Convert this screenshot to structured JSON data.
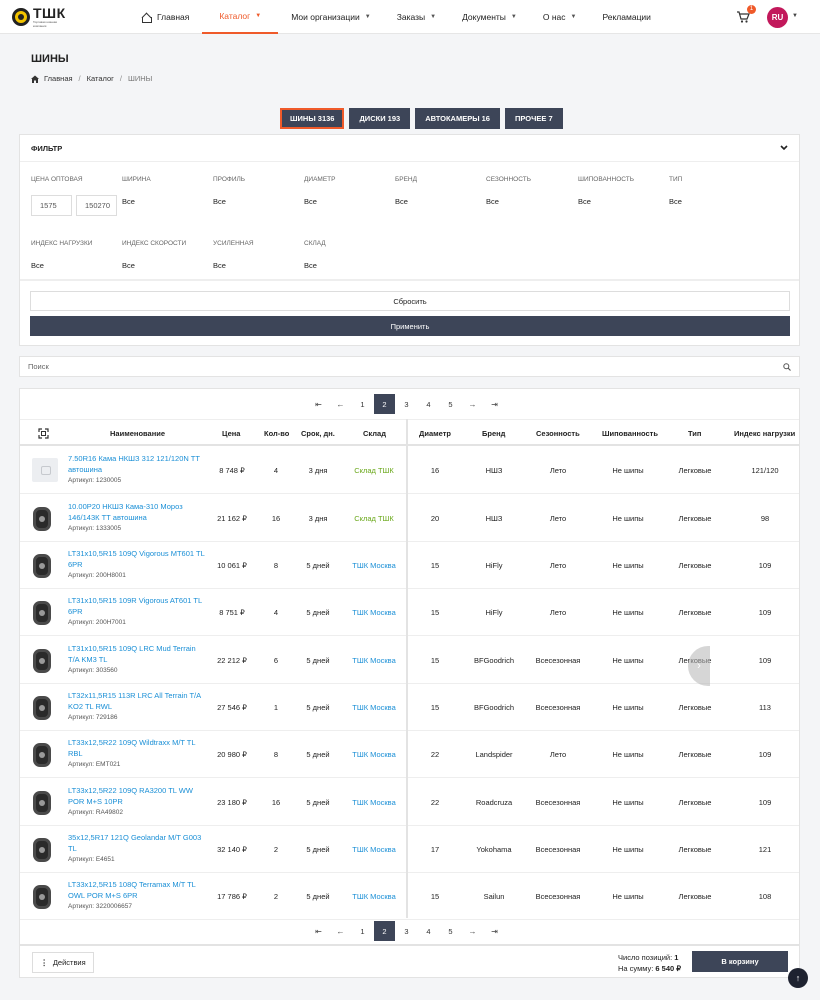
{
  "logo": {
    "text": "ТШК",
    "subtitle": "Торговая шинная компания"
  },
  "nav": {
    "home": "Главная",
    "catalog": "Каталог",
    "orgs": "Мои организации",
    "orders": "Заказы",
    "docs": "Документы",
    "about": "О нас",
    "ads": "Рекламации"
  },
  "header": {
    "cart_count": "1",
    "lang": "RU"
  },
  "page": {
    "title": "ШИНЫ",
    "breadcrumb": [
      "Главная",
      "Каталог",
      "ШИНЫ"
    ]
  },
  "categories": [
    {
      "label": "ШИНЫ 3136"
    },
    {
      "label": "ДИСКИ 193"
    },
    {
      "label": "АВТОКАМЕРЫ 16"
    },
    {
      "label": "ПРОЧЕЕ 7"
    }
  ],
  "filter": {
    "title": "ФИЛЬТР",
    "price_label": "ЦЕНА ОПТОВАЯ",
    "price_min": "1575",
    "price_max": "150270",
    "fields": [
      {
        "label": "ШИРИНА",
        "value": "Все"
      },
      {
        "label": "ПРОФИЛЬ",
        "value": "Все"
      },
      {
        "label": "ДИАМЕТР",
        "value": "Все"
      },
      {
        "label": "БРЕНД",
        "value": "Все"
      },
      {
        "label": "СЕЗОННОСТЬ",
        "value": "Все"
      },
      {
        "label": "ШИПОВАННОСТЬ",
        "value": "Все"
      },
      {
        "label": "ТИП",
        "value": "Все"
      },
      {
        "label": "ИНДЕКС НАГРУЗКИ",
        "value": "Все"
      },
      {
        "label": "ИНДЕКС СКОРОСТИ",
        "value": "Все"
      },
      {
        "label": "УСИЛЕННАЯ",
        "value": "Все"
      },
      {
        "label": "СКЛАД",
        "value": "Все"
      }
    ],
    "reset": "Сбросить",
    "apply": "Применить"
  },
  "search": {
    "placeholder": "Поиск"
  },
  "pagination": {
    "pages": [
      "1",
      "2",
      "3",
      "4",
      "5"
    ],
    "current": "2"
  },
  "table": {
    "columns": [
      "Наименование",
      "Цена",
      "Кол-во",
      "Срок, дн.",
      "Склад",
      "Диаметр",
      "Бренд",
      "Сезонность",
      "Шипованность",
      "Тип",
      "Индекс нагрузки"
    ],
    "rows": [
      {
        "name": "7.50R16 Кама НКШЗ 312 121/120N TT автошина",
        "article": "Артикул: 1230005",
        "price": "8 748 ₽",
        "qty": "4",
        "term": "3 дня",
        "stock": "Склад ТШК",
        "diameter": "16",
        "brand": "НШЗ",
        "season": "Лето",
        "studs": "Не шипы",
        "type": "Легковые",
        "load": "121/120"
      },
      {
        "name": "10.00Р20 НКШЗ Кама-310 Мороз 146/143К ТТ автошина",
        "article": "Артикул: 1333005",
        "price": "21 162 ₽",
        "qty": "16",
        "term": "3 дня",
        "stock": "Склад ТШК",
        "diameter": "20",
        "brand": "НШЗ",
        "season": "Лето",
        "studs": "Не шипы",
        "type": "Легковые",
        "load": "98"
      },
      {
        "name": "LT31x10,5R15 109Q Vigorous MT601 TL 6PR",
        "article": "Артикул: 200H8001",
        "price": "10 061 ₽",
        "qty": "8",
        "term": "5 дней",
        "stock": "ТШК Москва",
        "diameter": "15",
        "brand": "HiFly",
        "season": "Лето",
        "studs": "Не шипы",
        "type": "Легковые",
        "load": "109"
      },
      {
        "name": "LT31x10,5R15 109R Vigorous AT601 TL 6PR",
        "article": "Артикул: 200H7001",
        "price": "8 751 ₽",
        "qty": "4",
        "term": "5 дней",
        "stock": "ТШК Москва",
        "diameter": "15",
        "brand": "HiFly",
        "season": "Лето",
        "studs": "Не шипы",
        "type": "Легковые",
        "load": "109"
      },
      {
        "name": "LT31x10,5R15 109Q LRC Mud Terrain T/A KM3 TL",
        "article": "Артикул: 303560",
        "price": "22 212 ₽",
        "qty": "6",
        "term": "5 дней",
        "stock": "ТШК Москва",
        "diameter": "15",
        "brand": "BFGoodrich",
        "season": "Всесезонная",
        "studs": "Не шипы",
        "type": "Легковые",
        "load": "109"
      },
      {
        "name": "LT32x11,5R15 113R LRC All Terrain T/A KO2 TL RWL",
        "article": "Артикул: 729186",
        "price": "27 546 ₽",
        "qty": "1",
        "term": "5 дней",
        "stock": "ТШК Москва",
        "diameter": "15",
        "brand": "BFGoodrich",
        "season": "Всесезонная",
        "studs": "Не шипы",
        "type": "Легковые",
        "load": "113"
      },
      {
        "name": "LT33x12,5R22 109Q Wildtraxx M/T TL RBL",
        "article": "Артикул: EMT021",
        "price": "20 980 ₽",
        "qty": "8",
        "term": "5 дней",
        "stock": "ТШК Москва",
        "diameter": "22",
        "brand": "Landspider",
        "season": "Лето",
        "studs": "Не шипы",
        "type": "Легковые",
        "load": "109"
      },
      {
        "name": "LT33x12,5R22 109Q RA3200 TL WW POR M+S 10PR",
        "article": "Артикул: RA49802",
        "price": "23 180 ₽",
        "qty": "16",
        "term": "5 дней",
        "stock": "ТШК Москва",
        "diameter": "22",
        "brand": "Roadcruza",
        "season": "Всесезонная",
        "studs": "Не шипы",
        "type": "Легковые",
        "load": "109"
      },
      {
        "name": "35x12,5R17 121Q Geolandar M/T G003 TL",
        "article": "Артикул: E4651",
        "price": "32 140 ₽",
        "qty": "2",
        "term": "5 дней",
        "stock": "ТШК Москва",
        "diameter": "17",
        "brand": "Yokohama",
        "season": "Всесезонная",
        "studs": "Не шипы",
        "type": "Легковые",
        "load": "121"
      },
      {
        "name": "LT33x12,5R15 108Q Terramax M/T TL OWL POR M+S 6PR",
        "article": "Артикул: 3220006657",
        "price": "17 786 ₽",
        "qty": "2",
        "term": "5 дней",
        "stock": "ТШК Москва",
        "diameter": "15",
        "brand": "Sailun",
        "season": "Всесезонная",
        "studs": "Не шипы",
        "type": "Легковые",
        "load": "108"
      }
    ]
  },
  "footer": {
    "actions": "Действия",
    "positions_label": "Число позиций:",
    "positions_value": "1",
    "sum_label": "На сумму:",
    "sum_value": "6 540 ₽",
    "to_cart": "В корзину"
  },
  "colors": {
    "accent": "#ef5a2a",
    "primary": "#3d4558",
    "link": "#1a8fd6",
    "stock_local": "#6aa81a"
  }
}
